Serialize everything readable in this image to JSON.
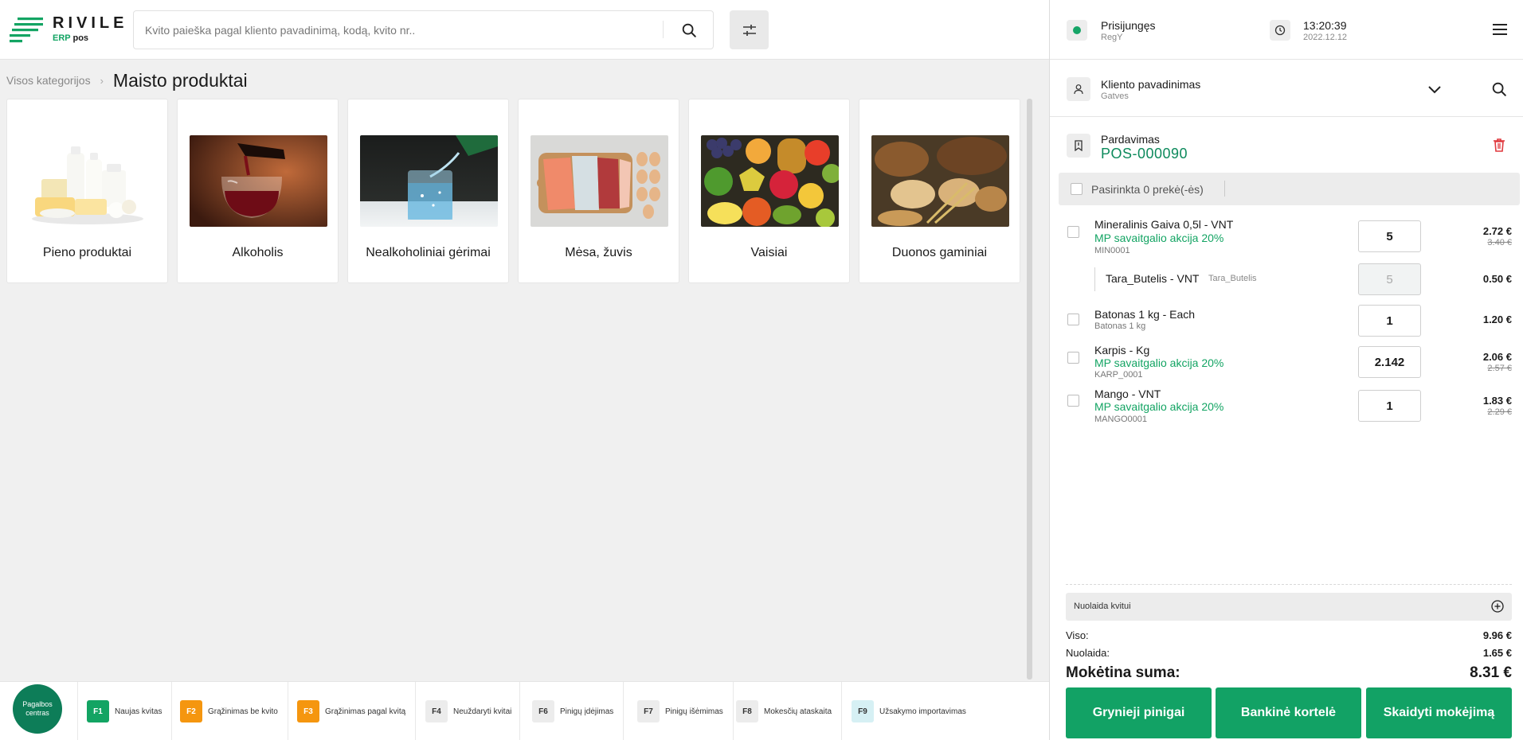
{
  "app": {
    "logo_name": "RIVILE",
    "logo_erp": "ERP",
    "logo_pos": "pos"
  },
  "search": {
    "placeholder": "Kvito paieška pagal kliento pavadinimą, kodą, kvito nr.."
  },
  "breadcrumb": {
    "root": "Visos kategorijos",
    "separator": "›",
    "current": "Maisto produktai"
  },
  "categories": [
    {
      "label": "Pieno produktai",
      "icon": "dairy-image"
    },
    {
      "label": "Alkoholis",
      "icon": "wine-image"
    },
    {
      "label": "Nealkoholiniai gėrimai",
      "icon": "water-image"
    },
    {
      "label": "Mėsa, žuvis",
      "icon": "meat-fish-image"
    },
    {
      "label": "Vaisiai",
      "icon": "fruits-image"
    },
    {
      "label": "Duonos gaminiai",
      "icon": "bread-image"
    }
  ],
  "bottom": {
    "help": "Pagalbos centras",
    "fkeys": [
      {
        "key": "F1",
        "label": "Naujas kvitas",
        "bg": "#13a463",
        "fg": "#ffffff"
      },
      {
        "key": "F2",
        "label": "Grąžinimas be kvito",
        "bg": "#f5960f",
        "fg": "#ffffff"
      },
      {
        "key": "F3",
        "label": "Grąžinimas pagal kvitą",
        "bg": "#f5960f",
        "fg": "#ffffff"
      },
      {
        "key": "F4",
        "label": "Neuždaryti kvitai",
        "bg": "#ececec",
        "fg": "#333333"
      },
      {
        "key": "F6",
        "label": "Pinigų įdėjimas",
        "bg": "#ececec",
        "fg": "#333333"
      },
      {
        "key": "F7",
        "label": "Pinigų išėmimas",
        "bg": "#ececec",
        "fg": "#333333"
      },
      {
        "key": "F8",
        "label": "Mokesčių ataskaita",
        "bg": "#ececec",
        "fg": "#333333"
      },
      {
        "key": "F9",
        "label": "Užsakymo importavimas",
        "bg": "#d6f0f4",
        "fg": "#333333"
      }
    ]
  },
  "session": {
    "status": "Prisijungęs",
    "user": "RegY",
    "time": "13:20:39",
    "date": "2022.12.12"
  },
  "client": {
    "name": "Kliento pavadinimas",
    "address": "Gatves"
  },
  "sale": {
    "title": "Pardavimas",
    "number": "POS-000090",
    "selected": "Pasirinkta 0 prekė(-ės)"
  },
  "lines": [
    {
      "name": "Mineralinis Gaiva 0,5l - VNT",
      "promo": "MP savaitgalio akcija 20%",
      "code": "MIN0001",
      "qty": "5",
      "price": "2.72 €",
      "old_price": "3.40 €"
    },
    {
      "sub": true,
      "name": "Tara_Butelis - VNT",
      "code": "Tara_Butelis",
      "qty": "5",
      "price": "0.50 €"
    },
    {
      "name": "Batonas 1 kg - Each",
      "code": "Batonas 1 kg",
      "qty": "1",
      "price": "1.20 €"
    },
    {
      "name": "Karpis - Kg",
      "promo": "MP savaitgalio akcija 20%",
      "code": "KARP_0001",
      "qty": "2.142",
      "price": "2.06 €",
      "old_price": "2.57 €"
    },
    {
      "name": "Mango - VNT",
      "promo": "MP savaitgalio akcija 20%",
      "code": "MANGO0001",
      "qty": "1",
      "price": "1.83 €",
      "old_price": "2.29 €"
    }
  ],
  "totals": {
    "discount_label": "Nuolaida kvitui",
    "viso_label": "Viso:",
    "viso": "9.96 €",
    "nuolaida_label": "Nuolaida:",
    "nuolaida": "1.65 €",
    "suma_label": "Mokėtina suma:",
    "suma": "8.31 €"
  },
  "payment": {
    "cash": "Grynieji pinigai",
    "card": "Bankinė kortelė",
    "split": "Skaidyti mokėjimą"
  },
  "colors": {
    "accent": "#13a463",
    "dark_accent": "#0d8a5c",
    "danger": "#e0393e"
  }
}
